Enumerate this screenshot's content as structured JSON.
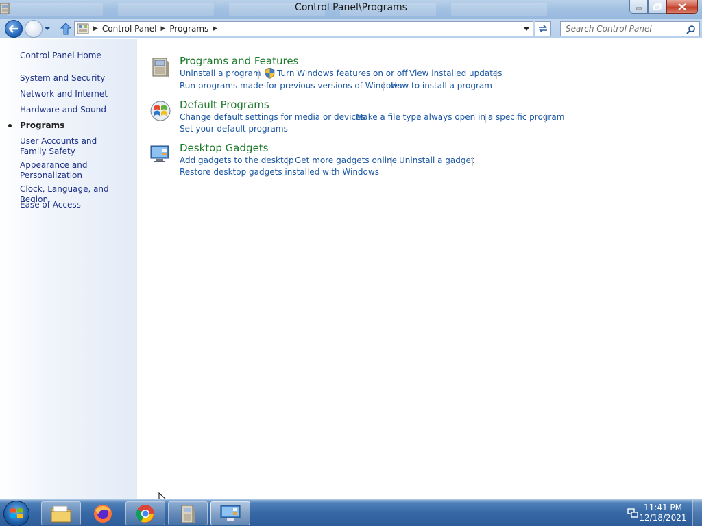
{
  "window": {
    "title": "Control Panel\\Programs"
  },
  "address": {
    "crumbs": [
      "Control Panel",
      "Programs"
    ]
  },
  "search": {
    "placeholder": "Search Control Panel"
  },
  "sidebar": {
    "items": [
      {
        "label": "Control Panel Home",
        "active": false
      },
      {
        "label": "System and Security",
        "active": false
      },
      {
        "label": "Network and Internet",
        "active": false
      },
      {
        "label": "Hardware and Sound",
        "active": false
      },
      {
        "label": "Programs",
        "active": true
      },
      {
        "label": "User Accounts and Family Safety",
        "active": false
      },
      {
        "label": "Appearance and Personalization",
        "active": false
      },
      {
        "label": "Clock, Language, and Region",
        "active": false
      },
      {
        "label": "Ease of Access",
        "active": false
      }
    ]
  },
  "categories": [
    {
      "title": "Programs and Features",
      "icon": "programs-features-icon",
      "links": [
        "Uninstall a program",
        "Turn Windows features on or off",
        "View installed updates",
        "Run programs made for previous versions of Windows",
        "How to install a program"
      ]
    },
    {
      "title": "Default Programs",
      "icon": "default-programs-icon",
      "links": [
        "Change default settings for media or devices",
        "Make a file type always open in a specific program",
        "Set your default programs"
      ]
    },
    {
      "title": "Desktop Gadgets",
      "icon": "desktop-gadgets-icon",
      "links": [
        "Add gadgets to the desktop",
        "Get more gadgets online",
        "Uninstall a gadget",
        "Restore desktop gadgets installed with Windows"
      ]
    }
  ],
  "taskbar": {
    "apps": [
      "windows-explorer-icon",
      "firefox-icon",
      "chrome-icon",
      "control-panel-icon",
      "gadgets-icon"
    ],
    "time": "11:41 PM",
    "date": "12/18/2021"
  },
  "colors": {
    "link": "#1c57a3",
    "category_title": "#1d7a2a",
    "sidebar_link": "#1e3287"
  }
}
